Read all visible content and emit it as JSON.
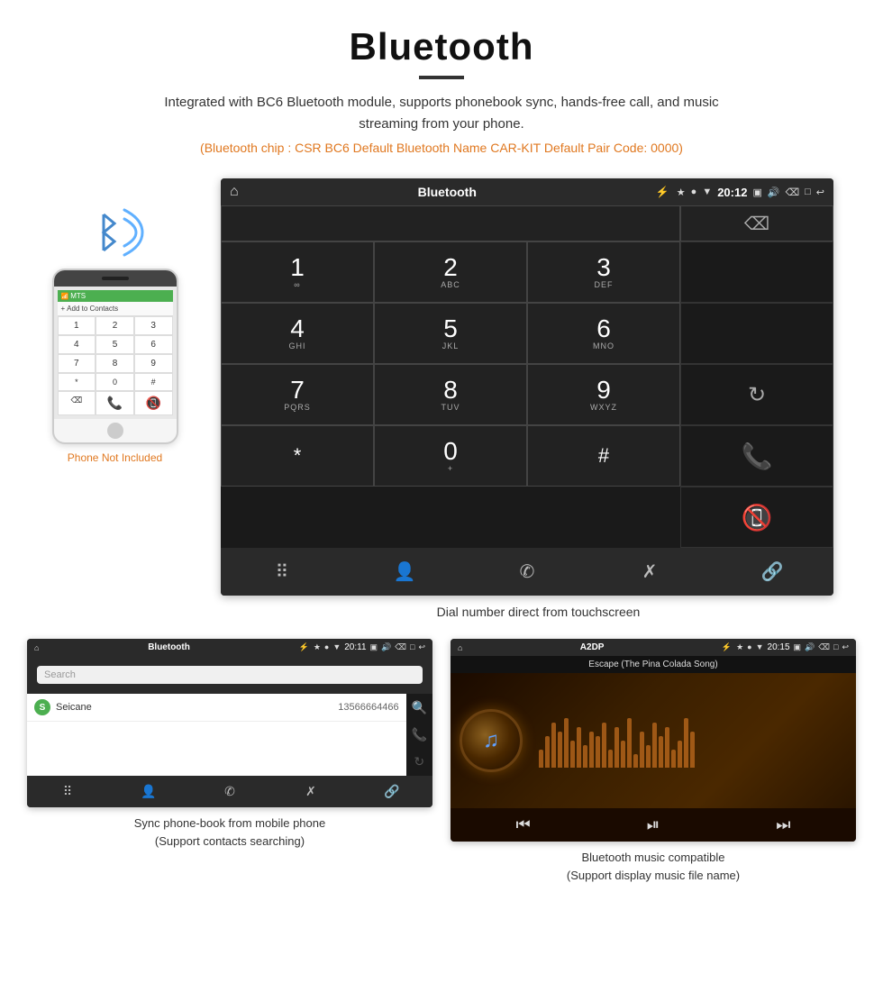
{
  "header": {
    "title": "Bluetooth",
    "description": "Integrated with BC6 Bluetooth module, supports phonebook sync, hands-free call, and music streaming from your phone.",
    "specs": "(Bluetooth chip : CSR BC6    Default Bluetooth Name CAR-KIT    Default Pair Code: 0000)"
  },
  "car_screen": {
    "status_bar": {
      "title": "Bluetooth",
      "time": "20:12"
    },
    "dial_keys": [
      {
        "main": "1",
        "sub": "∞"
      },
      {
        "main": "2",
        "sub": "ABC"
      },
      {
        "main": "3",
        "sub": "DEF"
      },
      {
        "main": "4",
        "sub": "GHI"
      },
      {
        "main": "5",
        "sub": "JKL"
      },
      {
        "main": "6",
        "sub": "MNO"
      },
      {
        "main": "7",
        "sub": "PQRS"
      },
      {
        "main": "8",
        "sub": "TUV"
      },
      {
        "main": "9",
        "sub": "WXYZ"
      },
      {
        "main": "*",
        "sub": ""
      },
      {
        "main": "0",
        "sub": "+"
      },
      {
        "main": "#",
        "sub": ""
      }
    ]
  },
  "dial_caption": "Dial number direct from touchscreen",
  "phonebook_screen": {
    "status_bar": {
      "title": "Bluetooth",
      "time": "20:11"
    },
    "search_placeholder": "Search",
    "contacts": [
      {
        "letter": "S",
        "name": "Seicane",
        "number": "13566664466"
      }
    ]
  },
  "phonebook_caption": "Sync phone-book from mobile phone\n(Support contacts searching)",
  "music_screen": {
    "status_bar": {
      "title": "A2DP",
      "time": "20:15"
    },
    "song_title": "Escape (The Pina Colada Song)"
  },
  "music_caption": "Bluetooth music compatible\n(Support display music file name)",
  "phone_not_included": "Phone Not Included"
}
